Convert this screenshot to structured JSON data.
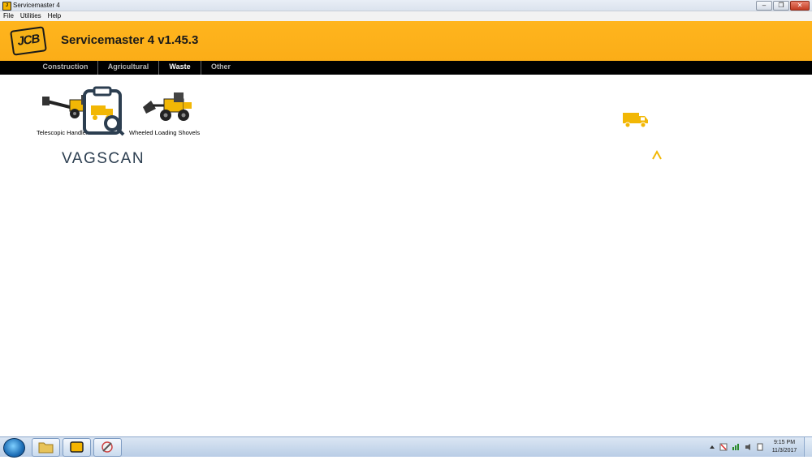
{
  "window": {
    "title": "Servicemaster 4",
    "controls": {
      "minimize": "–",
      "maximize": "❐",
      "close": "✕"
    }
  },
  "menu": {
    "items": [
      "File",
      "Utilities",
      "Help"
    ]
  },
  "banner": {
    "logo_text": "JCB",
    "title": "Servicemaster 4 v1.45.3",
    "color": "#fbad17"
  },
  "nav": {
    "tabs": [
      {
        "label": "Construction",
        "active": false
      },
      {
        "label": "Agricultural",
        "active": false
      },
      {
        "label": "Waste",
        "active": true
      },
      {
        "label": "Other",
        "active": false
      }
    ]
  },
  "machines": [
    {
      "label": "Telescopic Handlers",
      "icon": "telescopic-handler-icon"
    },
    {
      "label": "Wheeled Loading Shovels",
      "icon": "wheel-loader-icon"
    }
  ],
  "watermark": {
    "brand": "VAGSCAN",
    "accent": "#f2b705"
  },
  "taskbar": {
    "clock_time": "9:15 PM",
    "clock_date": "11/3/2017"
  }
}
